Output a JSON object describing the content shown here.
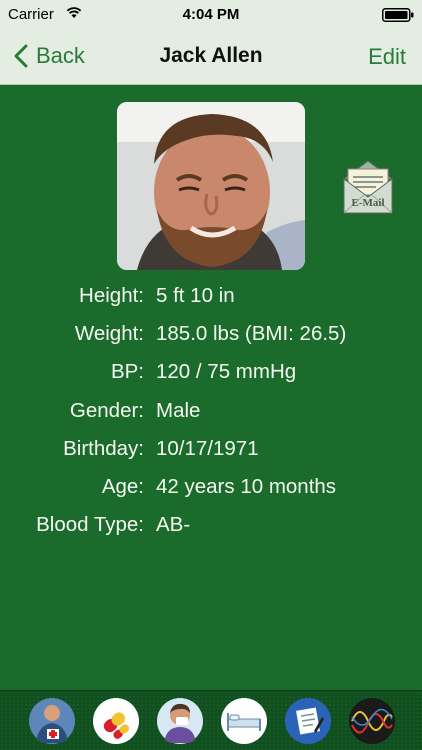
{
  "status_bar": {
    "carrier": "Carrier",
    "time": "4:04 PM"
  },
  "nav": {
    "back_label": "Back",
    "title": "Jack Allen",
    "edit_label": "Edit"
  },
  "email_button": {
    "label": "E-Mail"
  },
  "profile": {
    "rows": [
      {
        "label": "Height:",
        "value": "5 ft 10 in"
      },
      {
        "label": "Weight:",
        "value": "185.0 lbs (BMI: 26.5)"
      },
      {
        "label": "BP:",
        "value": "120 / 75 mmHg"
      },
      {
        "label": "Gender:",
        "value": "Male"
      },
      {
        "label": "Birthday:",
        "value": "10/17/1971"
      },
      {
        "label": "Age:",
        "value": "42 years 10 months"
      },
      {
        "label": "Blood Type:",
        "value": "AB-"
      }
    ]
  },
  "tab_bar": {
    "icons": [
      "doctor-icon",
      "pills-icon",
      "sick-person-icon",
      "bed-icon",
      "notepad-icon",
      "waveform-icon"
    ]
  },
  "colors": {
    "accent": "#2a7a3a",
    "background": "#1a6b2c",
    "header": "#e3ede1"
  }
}
